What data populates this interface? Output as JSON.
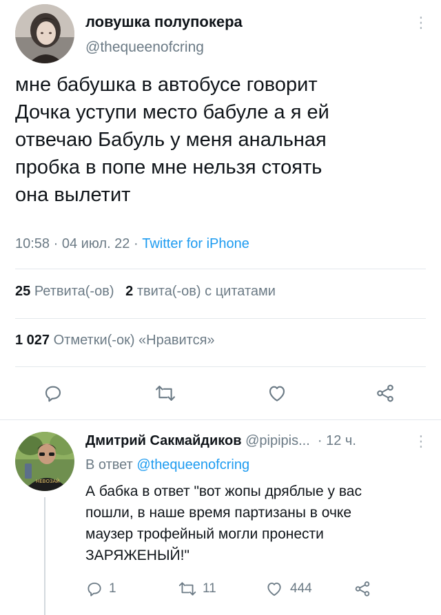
{
  "tweet": {
    "author_name": "ловушка полупокера",
    "author_handle": "@thequeenofcring",
    "text_lines": [
      "мне бабушка в автобусе говорит",
      "Дочка уступи место бабуле а я ей",
      "отвечаю Бабуль у меня анальная",
      "пробка в попе мне нельзя стоять",
      "она вылетит"
    ],
    "time": "10:58",
    "separator": "·",
    "date": "04 июл. 22",
    "client": "Twitter for iPhone",
    "retweets_count": "25",
    "retweets_label": "Ретвита(-ов)",
    "quotes_count": "2",
    "quotes_label": "твита(-ов) с цитатами",
    "likes_count": "1 027",
    "likes_label": "Отметки(-ок) «Нравится»",
    "actions": [
      "reply-icon",
      "retweet-icon",
      "like-icon",
      "share-icon"
    ]
  },
  "reply": {
    "author_name": "Дмитрий Сакмайдиков",
    "author_handle": "@pipipis...",
    "time": "· 12 ч.",
    "reply_to_prefix": "В ответ",
    "reply_to_handle": "@thequeenofcring",
    "text_lines": [
      "А бабка в ответ \"вот жопы дряблые у вас",
      "пошли, в наше время партизаны в очке",
      "маузер трофейный могли пронести",
      "ЗАРЯЖЕНЫЙ!\""
    ],
    "reply_count": "1",
    "retweet_count": "11",
    "like_count": "444",
    "avatar_badge": "НЕВОЗАЙ"
  },
  "colors": {
    "accent": "#1d9bf0",
    "muted": "#6b7a85",
    "text": "#0f1419",
    "divider": "#e3e8ec"
  }
}
